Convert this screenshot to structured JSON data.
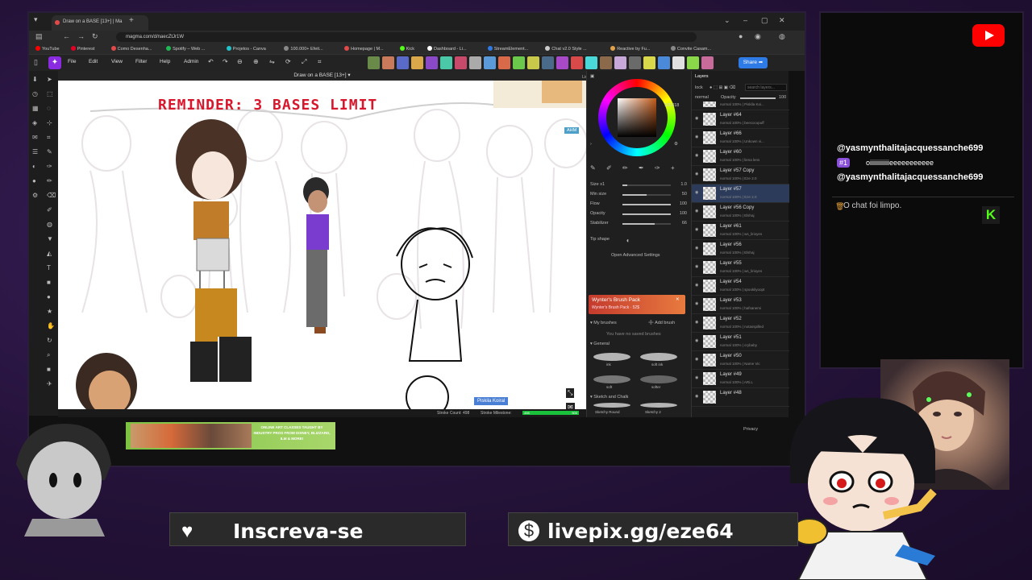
{
  "browser": {
    "tab_title": "Draw on a BASE [13+] | Ma",
    "url": "magma.com/d/naecZtJr1W",
    "bookmarks": [
      {
        "label": "YouTube",
        "color": "#ff0000"
      },
      {
        "label": "Pinterest",
        "color": "#e60023"
      },
      {
        "label": "Como Desenha...",
        "color": "#e24a4a"
      },
      {
        "label": "Spotify – Web ...",
        "color": "#1db954"
      },
      {
        "label": "Projetos - Canva",
        "color": "#20c4cb"
      },
      {
        "label": "100.000+ Efeit...",
        "color": "#888888"
      },
      {
        "label": "Homepage | M...",
        "color": "#e24a4a"
      },
      {
        "label": "Kick",
        "color": "#53fc18"
      },
      {
        "label": "Dashboard - Li...",
        "color": "#ffffff"
      },
      {
        "label": "StreamElement...",
        "color": "#2f7be6"
      },
      {
        "label": "Chat v2.0 Style ...",
        "color": "#cccccc"
      },
      {
        "label": "Reactive by Fu...",
        "color": "#e2a24a"
      },
      {
        "label": "Convite Casam...",
        "color": "#888888"
      }
    ]
  },
  "app": {
    "menu": [
      "File",
      "Edit",
      "View",
      "Filter",
      "Help",
      "Admin"
    ],
    "share_label": "Share",
    "canvas_title": "Draw on a BASE [13+]",
    "license_label": "License",
    "reminder": "REMINDER: 3 BASES LIMIT",
    "collaborator_label": "Piskila Koiral",
    "ahm_label": "AHM",
    "status": {
      "stroke_count": "Stroke Count: 498",
      "stroke_milestone": "Stroke Milestone:",
      "milestone_value": "498",
      "milestone_max": "500",
      "milestone_fraction": 0.996
    }
  },
  "brush_panel": {
    "hex": "181818",
    "size_label": "Size x1",
    "size_value": "1.0",
    "min_size_label": "Min size",
    "min_size_value": "50",
    "flow_label": "Flow",
    "flow_value": "100",
    "opacity_label": "Opacity",
    "opacity_value": "100",
    "stabilizer_label": "Stabilizer",
    "stabilizer_value": "66",
    "tip_shape_label": "Tip shape",
    "advanced_label": "Open Advanced Settings",
    "pack_title": "Wynter's Brush Pack",
    "pack_sub": "Wynter's Brush Pack · 52$",
    "my_brushes_label": "My brushes",
    "add_brush_label": "Add brush",
    "no_brushes_label": "You have no saved brushes",
    "general_label": "General",
    "brushes": [
      "ink",
      "soft ink",
      "soft",
      "softer"
    ],
    "sketch_label": "Sketch and Chalk",
    "sketch_brushes": [
      "Sketchy Round",
      "Sketchy 2"
    ]
  },
  "layers_panel": {
    "tabs": [
      "Layers"
    ],
    "lock_label": "lock",
    "search_placeholder": "search layers...",
    "opacity_label": "Opacity",
    "opacity_value": "100",
    "blend_label": "normal",
    "layers": [
      {
        "name": "",
        "sub": "normal 100% | Piskila Koi..."
      },
      {
        "name": "Layer #64",
        "sub": "normal 100% | beecocopuff"
      },
      {
        "name": "Layer #66",
        "sub": "normal 100% | Unkown vi..."
      },
      {
        "name": "Layer #60",
        "sub": "normal 100% | liena lens"
      },
      {
        "name": "Layer #57 Copy",
        "sub": "normal 100% | Eze 2.0"
      },
      {
        "name": "Layer #57",
        "sub": "normal 100% | Eze 2.0",
        "selected": true
      },
      {
        "name": "Layer #56 Copy",
        "sub": "normal 100% | Elshaj"
      },
      {
        "name": "Layer #61",
        "sub": "normal 100% | ws_lirioyes"
      },
      {
        "name": "Layer #56",
        "sub": "normal 100% | Elshaj"
      },
      {
        "name": "Layer #55",
        "sub": "normal 100% | ws_lirioyes"
      },
      {
        "name": "Layer #54",
        "sub": "normal 100% | spookilyoopt"
      },
      {
        "name": "Layer #53",
        "sub": "normal 100% | hafsanemi"
      },
      {
        "name": "Layer #52",
        "sub": "normal 100% | notasspilled"
      },
      {
        "name": "Layer #51",
        "sub": "normal 100% | crybaby"
      },
      {
        "name": "Layer #50",
        "sub": "normal 100% | Name Vic"
      },
      {
        "name": "Layer #49",
        "sub": "normal 100% | ARi.L"
      },
      {
        "name": "Layer #48",
        "sub": ""
      }
    ]
  },
  "ad": {
    "text": "ONLINE ART CLASSES TAUGHT BY INDUSTRY PROS FROM DISNEY, BLIZZARD, ILM & MORE!"
  },
  "privacy_label": "Privacy",
  "chat": {
    "messages": [
      {
        "user": "@yasmynthalitajacquessanche699",
        "badge": "#1",
        "text": "oiiiiiiiiiiiieeeeeeeeeee"
      },
      {
        "user": "@yasmynthalitajacquessanche699"
      }
    ],
    "cleared": "O chat foi limpo."
  },
  "overlay": {
    "subscribe": "Inscreva-se",
    "livepix": "livepix.gg/eze64"
  },
  "colors": {
    "brand": "#8a2be2",
    "share": "#2f7be6",
    "reminder": "#d8162c",
    "kick": "#53fc18",
    "youtube": "#ff0000",
    "milestone": "#19c23a"
  }
}
